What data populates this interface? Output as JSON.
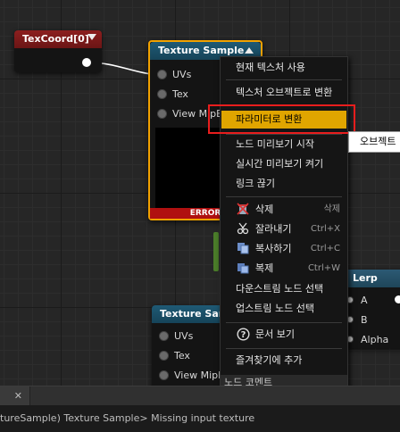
{
  "nodes": {
    "texcoord": {
      "title": "TexCoord[0]"
    },
    "texture_sample_1": {
      "title": "Texture Sample",
      "pins": [
        "UVs",
        "Tex",
        "View MipB"
      ],
      "error": "ERROR"
    },
    "texture_sample_2": {
      "title": "Texture Samp",
      "pins": [
        "UVs",
        "Tex",
        "View MipB"
      ]
    },
    "lerp": {
      "title": "Lerp",
      "pins": [
        "A",
        "B",
        "Alpha"
      ]
    }
  },
  "context_menu": {
    "items": [
      {
        "label": "현재 텍스처 사용"
      },
      {
        "label": "텍스처 오브젝트로 변환"
      },
      {
        "label": "파라미터로 변환"
      },
      {
        "label": "노드 미리보기 시작"
      },
      {
        "label": "실시간 미리보기 켜기"
      },
      {
        "label": "링크 끊기"
      },
      {
        "label": "삭제",
        "shortcut": "삭제",
        "icon": "delete-icon"
      },
      {
        "label": "잘라내기",
        "shortcut": "Ctrl+X",
        "icon": "cut-icon"
      },
      {
        "label": "복사하기",
        "shortcut": "Ctrl+C",
        "icon": "copy-icon"
      },
      {
        "label": "복제",
        "shortcut": "Ctrl+W",
        "icon": "duplicate-icon"
      },
      {
        "label": "다운스트림 노드 선택"
      },
      {
        "label": "업스트림 노드 선택"
      },
      {
        "label": "문서 보기",
        "icon": "help-icon"
      },
      {
        "label": "즐겨찾기에 추가"
      }
    ],
    "comment_label": "노드 코멘트",
    "comment_value": ""
  },
  "submenu": {
    "label": "오브젝트"
  },
  "tab": {
    "close": "✕"
  },
  "status": {
    "text": "tureSample) Texture Sample> Missing input texture"
  },
  "colors": {
    "highlight": "#e0a500",
    "red_box": "#e81d1d",
    "selection_border": "#f2a200"
  }
}
